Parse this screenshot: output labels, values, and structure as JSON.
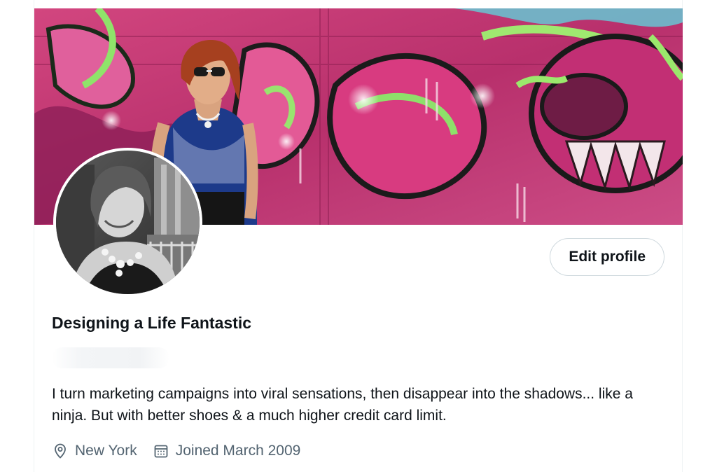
{
  "profile": {
    "display_name": "Designing a Life Fantastic",
    "bio": "I turn marketing campaigns into viral sensations, then disappear into the shadows... like a ninja. But with better shoes & a much higher credit card limit.",
    "location": "New York",
    "joined": "Joined March 2009"
  },
  "actions": {
    "edit_profile_label": "Edit profile"
  },
  "icons": {
    "location": "location-pin-icon",
    "joined": "calendar-icon"
  },
  "colors": {
    "text_primary": "#0f1419",
    "text_secondary": "#536471",
    "button_border": "#cfd9de",
    "banner_primary": "#c23a78"
  }
}
